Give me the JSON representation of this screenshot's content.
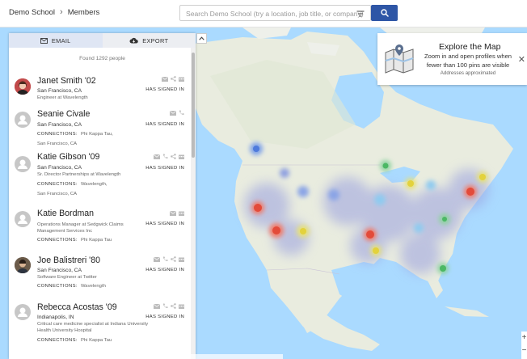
{
  "breadcrumb": {
    "root": "Demo School",
    "current": "Members"
  },
  "search": {
    "placeholder": "Search Demo School (try a location, job title, or company)"
  },
  "panel": {
    "email_tab": "EMAIL",
    "export_tab": "EXPORT",
    "found_text": "Found 1292 people",
    "signed_label": "HAS SIGNED IN",
    "connections_label": "CONNECTIONS:"
  },
  "people": [
    {
      "name": "Janet Smith '02",
      "location": "San Francisco, CA",
      "sub": "Engineer at Wavelength",
      "connections": "",
      "connections2": ""
    },
    {
      "name": "Seanie Civale",
      "location": "San Francisco, CA",
      "sub": "",
      "connections": "Phi Kappa Tau,",
      "connections2": "San Francisco, CA"
    },
    {
      "name": "Katie Gibson '09",
      "location": "San Francisco, CA",
      "sub": "Sr. Director Partnerships at Wavelength",
      "connections": "Wavelength,",
      "connections2": "San Francisco, CA"
    },
    {
      "name": "Katie Bordman",
      "location": "",
      "sub": "Operations Manager at Sedgwick Claims Management Services Inc",
      "connections": "Phi Kappa Tau",
      "connections2": ""
    },
    {
      "name": "Joe Balistreri '80",
      "location": "San Francisco, CA",
      "sub": "Software Engineer at Twitter",
      "connections": "Wavelength",
      "connections2": ""
    },
    {
      "name": "Rebecca Acostas '09",
      "location": "Indianapolis, IN",
      "sub": "Critical care medicine specialist at Indiana University Health University Hospital",
      "connections": "Phi Kappa Tau",
      "connections2": ""
    }
  ],
  "explore": {
    "title": "Explore the Map",
    "body": "Zoom in and open profiles when fewer than 100 pins are visible",
    "note": "Addresses approximated"
  },
  "zoom": {
    "in": "+",
    "out": "−"
  },
  "colors": {
    "accent": "#2e56a6",
    "water": "#aadaff",
    "land": "#e9ecdf"
  }
}
